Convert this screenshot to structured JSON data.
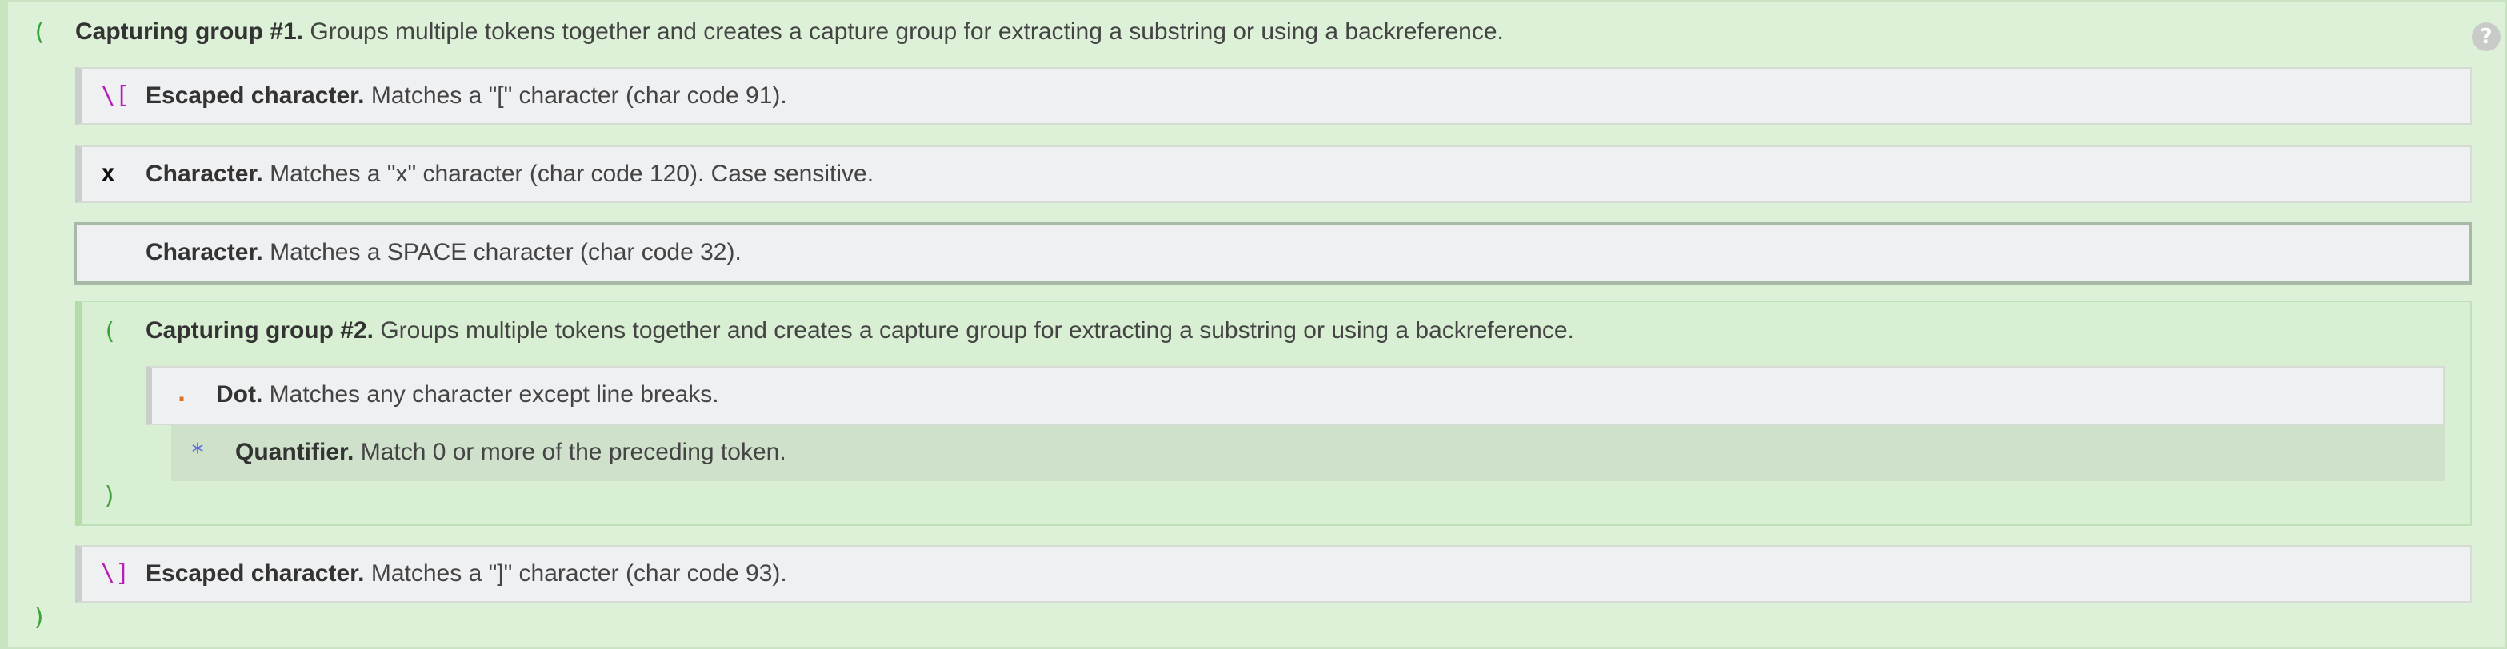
{
  "help_icon_glyph": "?",
  "tokens": {
    "group1": {
      "open": "(",
      "close": ")",
      "title": "Capturing group #1.",
      "text": " Groups multiple tokens together and creates a capture group for extracting a substring or using a backreference."
    },
    "esc_open": {
      "token": "\\[",
      "title": "Escaped character.",
      "text": " Matches a \"[\" character (char code 91)."
    },
    "char_x": {
      "token": "x",
      "title": "Character.",
      "text": " Matches a \"x\" character (char code 120). Case sensitive."
    },
    "char_space": {
      "token": "",
      "title": "Character.",
      "text": " Matches a SPACE character (char code 32)."
    },
    "group2": {
      "open": "(",
      "close": ")",
      "title": "Capturing group #2.",
      "text": " Groups multiple tokens together and creates a capture group for extracting a substring or using a backreference."
    },
    "dot": {
      "token": ".",
      "title": "Dot.",
      "text": " Matches any character except line breaks."
    },
    "quantifier": {
      "token": "*",
      "title": "Quantifier.",
      "text": " Match 0 or more of the preceding token."
    },
    "esc_close": {
      "token": "\\]",
      "title": "Escaped character.",
      "text": " Matches a \"]\" character (char code 93)."
    }
  },
  "colors": {
    "group_bg": "#dcf1d7",
    "group_token": "#3aa43a",
    "escape_token": "#b51fb5",
    "dot_token": "#e06d1e",
    "quantifier_token": "#5b6fe0",
    "item_bg": "#eff0f2"
  }
}
